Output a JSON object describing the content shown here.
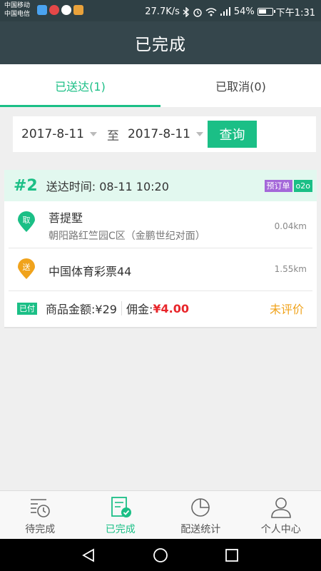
{
  "status_bar": {
    "carrier1": "中国移动",
    "carrier2": "中国电信",
    "speed": "27.7K/s",
    "battery": "54%",
    "time": "下午1:31",
    "icons": [
      "bluetooth-icon",
      "alarm-icon",
      "wifi-icon",
      "signal-icon",
      "battery-icon"
    ]
  },
  "title": "已完成",
  "tabs": [
    {
      "label": "已送达(1)",
      "active": true
    },
    {
      "label": "已取消(0)",
      "active": false
    }
  ],
  "filter": {
    "start_date": "2017-8-11",
    "to_label": "至",
    "end_date": "2017-8-11",
    "query_label": "查询"
  },
  "order": {
    "number": "#2",
    "delivery_time": "送达时间: 08-11 10:20",
    "badge_preorder": "预订单",
    "badge_o2o": "o2o",
    "pickup": {
      "pin_label": "取",
      "name": "菩提墅",
      "address": "朝阳路红竺园C区（金鹏世纪对面）",
      "distance": "0.04km"
    },
    "dropoff": {
      "pin_label": "送",
      "name": "中国体育彩票44",
      "distance": "1.55km"
    },
    "paid_badge": "已付",
    "goods_amount": "商品金额:¥29",
    "commission_label": "佣金:",
    "commission_value": "¥4.00",
    "rating_status": "未评价"
  },
  "bottom_nav": [
    {
      "label": "待完成",
      "icon": "pending-list-icon",
      "active": false
    },
    {
      "label": "已完成",
      "icon": "completed-doc-icon",
      "active": true
    },
    {
      "label": "配送统计",
      "icon": "pie-chart-icon",
      "active": false
    },
    {
      "label": "个人中心",
      "icon": "person-icon",
      "active": false
    }
  ],
  "colors": {
    "accent": "#1bbf86",
    "header_bg": "#35464c",
    "pickup_pin": "#1bbf86",
    "dropoff_pin": "#f0a31c",
    "commission": "#e8262b",
    "rating": "#f0a31c",
    "preorder_badge": "#a468d9"
  }
}
